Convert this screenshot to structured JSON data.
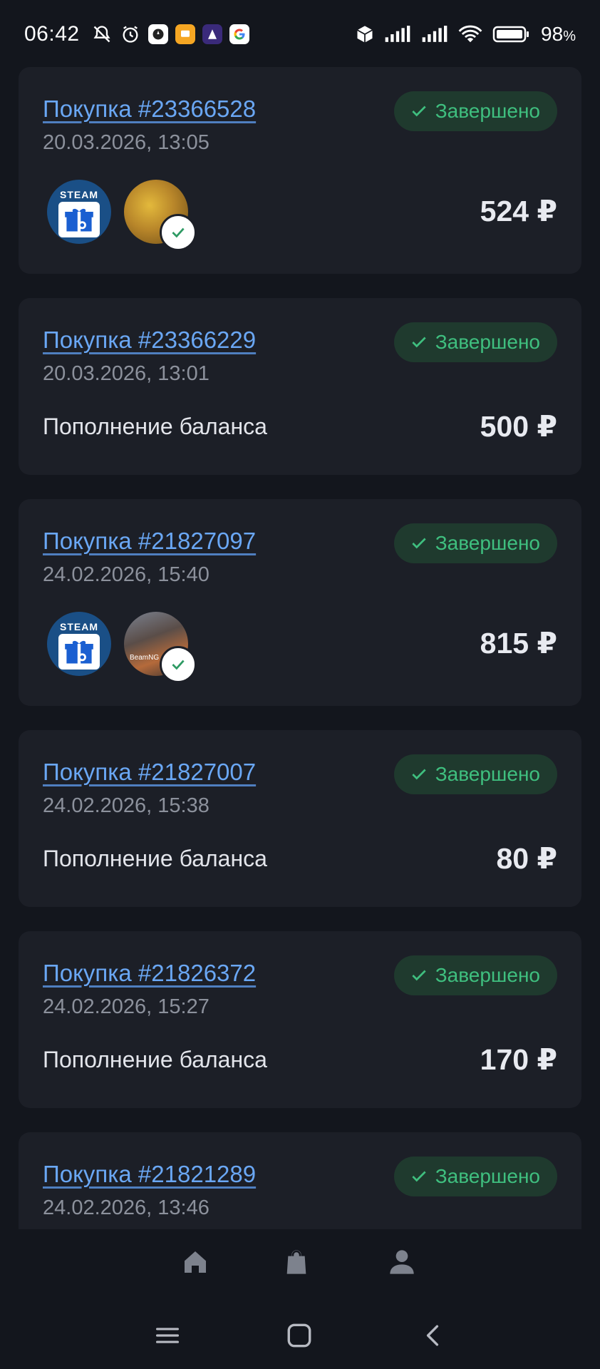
{
  "status_bar": {
    "time": "06:42",
    "battery": "98",
    "battery_unit": "%",
    "icons": [
      "notifications-muted-icon",
      "alarm-icon",
      "app-icon",
      "app-icon",
      "app-icon",
      "google-icon",
      "cube-icon",
      "signal-icon",
      "signal-icon",
      "wifi-icon",
      "battery-icon"
    ]
  },
  "orders": [
    {
      "title": "Покупка #23366528",
      "date": "20.03.2026, 13:05",
      "status": "Завершено",
      "amount": "524 ₽",
      "kind": "items"
    },
    {
      "title": "Покупка #23366229",
      "date": "20.03.2026, 13:01",
      "status": "Завершено",
      "amount": "500 ₽",
      "kind": "topup",
      "label": "Пополнение баланса"
    },
    {
      "title": "Покупка #21827097",
      "date": "24.02.2026, 15:40",
      "status": "Завершено",
      "amount": "815 ₽",
      "kind": "items"
    },
    {
      "title": "Покупка #21827007",
      "date": "24.02.2026, 15:38",
      "status": "Завершено",
      "amount": "80 ₽",
      "kind": "topup",
      "label": "Пополнение баланса"
    },
    {
      "title": "Покупка #21826372",
      "date": "24.02.2026, 15:27",
      "status": "Завершено",
      "amount": "170 ₽",
      "kind": "topup",
      "label": "Пополнение баланса"
    },
    {
      "title": "Покупка #21821289",
      "date": "24.02.2026, 13:46",
      "status": "Завершено"
    }
  ],
  "thumb_text": {
    "steam": "STEAM",
    "game2": "BeamNG"
  },
  "colors": {
    "background": "#13161d",
    "card": "#1c1f27",
    "link": "#6aa7f4",
    "status_green": "#3fbf7f",
    "status_bg": "#1f3a2e"
  },
  "tabbar": [
    "home-icon",
    "shopping-bag-icon",
    "profile-icon"
  ],
  "system_nav": [
    "menu-icon",
    "home-square-icon",
    "back-icon"
  ]
}
